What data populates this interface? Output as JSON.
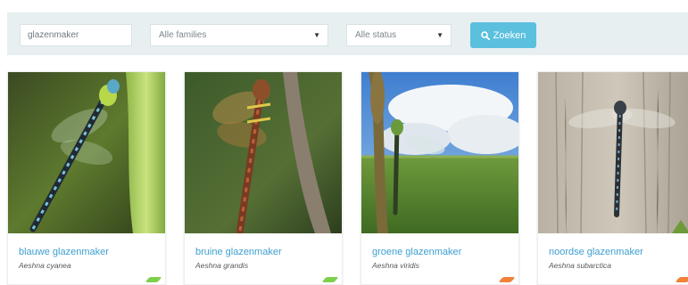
{
  "search": {
    "value": "glazenmaker"
  },
  "filters": {
    "families": {
      "selected": "Alle families"
    },
    "status": {
      "selected": "Alle status"
    }
  },
  "search_button": {
    "label": "Zoeken",
    "icon": "search-icon",
    "color": "#5bc0de"
  },
  "cards": [
    {
      "name": "blauwe glazenmaker",
      "latin": "Aeshna cyanea",
      "tag_color": "#7fcf4e"
    },
    {
      "name": "bruine glazenmaker",
      "latin": "Aeshna grandis",
      "tag_color": "#7fcf4e"
    },
    {
      "name": "groene glazenmaker",
      "latin": "Aeshna viridis",
      "tag_color": "#f0823a"
    },
    {
      "name": "noordse glazenmaker",
      "latin": "Aeshna subarctica",
      "tag_color": "#f0823a"
    }
  ]
}
